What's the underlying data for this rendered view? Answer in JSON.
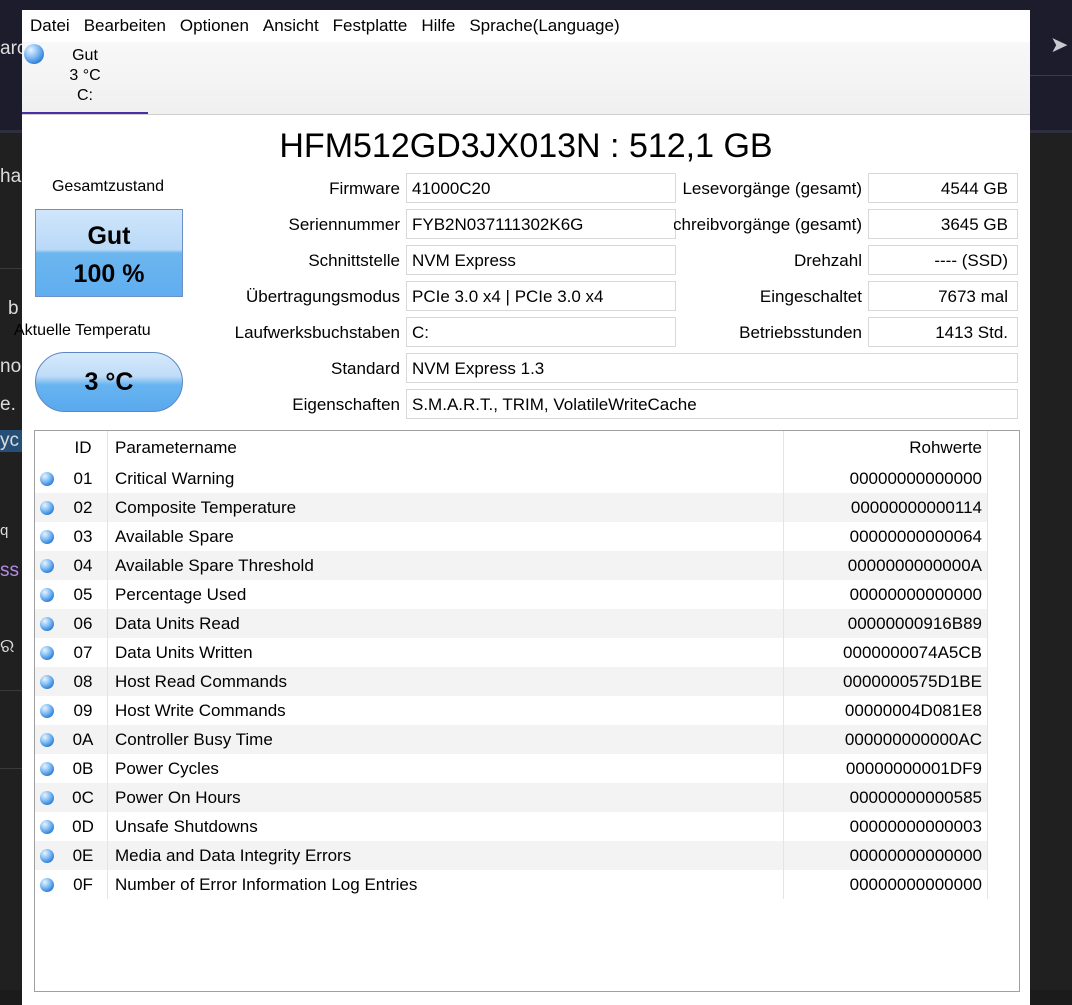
{
  "background": {
    "fragments": [
      "arc",
      "ha",
      "b",
      "no",
      "e.",
      "yc",
      "q",
      "ss",
      "ର"
    ]
  },
  "menu": [
    "Datei",
    "Bearbeiten",
    "Optionen",
    "Ansicht",
    "Festplatte",
    "Hilfe",
    "Sprache(Language)"
  ],
  "disk_tab": {
    "status": "Gut",
    "temperature": "3 °C",
    "drive": "C:"
  },
  "title": "HFM512GD3JX013N : 512,1 GB",
  "health": {
    "label": "Gesamtzustand",
    "status": "Gut",
    "percent": "100 %"
  },
  "temperature": {
    "label": "Aktuelle Temperatu",
    "value": "3 °C"
  },
  "info_left": [
    {
      "label": "Firmware",
      "value": "41000C20"
    },
    {
      "label": "Seriennummer",
      "value": "FYB2N037111302K6G"
    },
    {
      "label": "Schnittstelle",
      "value": "NVM Express"
    },
    {
      "label": "Übertragungsmodus",
      "value": "PCIe 3.0 x4 | PCIe 3.0 x4"
    },
    {
      "label": "Laufwerksbuchstaben",
      "value": "C:"
    },
    {
      "label": "Standard",
      "value": "NVM Express 1.3"
    },
    {
      "label": "Eigenschaften",
      "value": "S.M.A.R.T., TRIM, VolatileWriteCache"
    }
  ],
  "info_right": [
    {
      "label": "Lesevorgänge (gesamt)",
      "value": "4544 GB"
    },
    {
      "label": "Schreibvorgänge (gesamt)",
      "value": "3645 GB"
    },
    {
      "label": "Drehzahl",
      "value": "---- (SSD)"
    },
    {
      "label": "Eingeschaltet",
      "value": "7673 mal"
    },
    {
      "label": "Betriebsstunden",
      "value": "1413 Std."
    }
  ],
  "smart": {
    "headers": {
      "id": "ID",
      "name": "Parametername",
      "raw": "Rohwerte"
    },
    "status_color": "#3a8ee6",
    "rows": [
      {
        "id": "01",
        "name": "Critical Warning",
        "raw": "00000000000000"
      },
      {
        "id": "02",
        "name": "Composite Temperature",
        "raw": "00000000000114"
      },
      {
        "id": "03",
        "name": "Available Spare",
        "raw": "00000000000064"
      },
      {
        "id": "04",
        "name": "Available Spare Threshold",
        "raw": "0000000000000A"
      },
      {
        "id": "05",
        "name": "Percentage Used",
        "raw": "00000000000000"
      },
      {
        "id": "06",
        "name": "Data Units Read",
        "raw": "00000000916B89"
      },
      {
        "id": "07",
        "name": "Data Units Written",
        "raw": "0000000074A5CB"
      },
      {
        "id": "08",
        "name": "Host Read Commands",
        "raw": "0000000575D1BE"
      },
      {
        "id": "09",
        "name": "Host Write Commands",
        "raw": "00000004D081E8"
      },
      {
        "id": "0A",
        "name": "Controller Busy Time",
        "raw": "000000000000AC"
      },
      {
        "id": "0B",
        "name": "Power Cycles",
        "raw": "00000000001DF9"
      },
      {
        "id": "0C",
        "name": "Power On Hours",
        "raw": "00000000000585"
      },
      {
        "id": "0D",
        "name": "Unsafe Shutdowns",
        "raw": "00000000000003"
      },
      {
        "id": "0E",
        "name": "Media and Data Integrity Errors",
        "raw": "00000000000000"
      },
      {
        "id": "0F",
        "name": "Number of Error Information Log Entries",
        "raw": "00000000000000"
      }
    ]
  }
}
